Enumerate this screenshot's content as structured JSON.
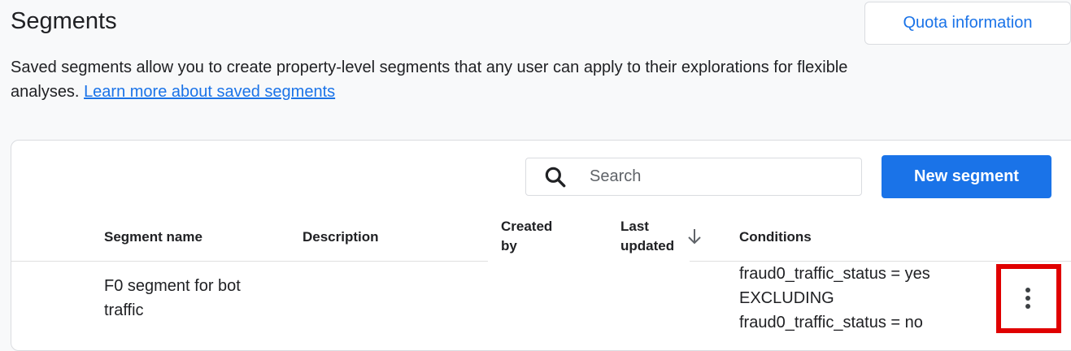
{
  "page": {
    "title": "Segments",
    "quota_button": "Quota information",
    "description": "Saved segments allow you to create property-level segments that any user can apply to their explorations for flexible analyses.",
    "learn_more_link": "Learn more about saved segments"
  },
  "toolbar": {
    "search_placeholder": "Search",
    "search_value": "",
    "new_segment_button": "New segment"
  },
  "table": {
    "columns": {
      "segment_name": "Segment name",
      "description": "Description",
      "created_by_line1": "Created",
      "created_by_line2": "by",
      "last_updated_line1": "Last",
      "last_updated_line2": "updated",
      "conditions": "Conditions"
    },
    "sort": "descending",
    "rows": [
      {
        "name_line1": "F0 segment for bot",
        "name_line2": "traffic",
        "description": "",
        "conditions": [
          "fraud0_traffic_status = yes",
          "EXCLUDING",
          "fraud0_traffic_status = no"
        ]
      }
    ]
  },
  "icons": {
    "search": "search-icon",
    "sort": "arrow-down-icon",
    "more": "more-vert-icon"
  },
  "colors": {
    "primary": "#1a73e8",
    "highlight": "#e00000"
  }
}
